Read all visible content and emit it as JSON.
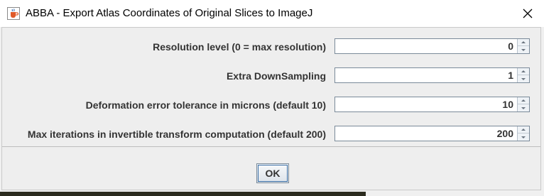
{
  "window": {
    "title": "ABBA - Export Atlas Coordinates of Original Slices to ImageJ",
    "app_icon": "java-cup-icon",
    "close_icon": "close-icon"
  },
  "fields": [
    {
      "label": "Resolution level (0 = max resolution)",
      "value": "0"
    },
    {
      "label": "Extra DownSampling",
      "value": "1"
    },
    {
      "label": "Deformation error tolerance in microns (default 10)",
      "value": "10"
    },
    {
      "label": "Max iterations in invertible transform computation (default 200)",
      "value": "200"
    }
  ],
  "buttons": {
    "ok_label": "OK"
  }
}
